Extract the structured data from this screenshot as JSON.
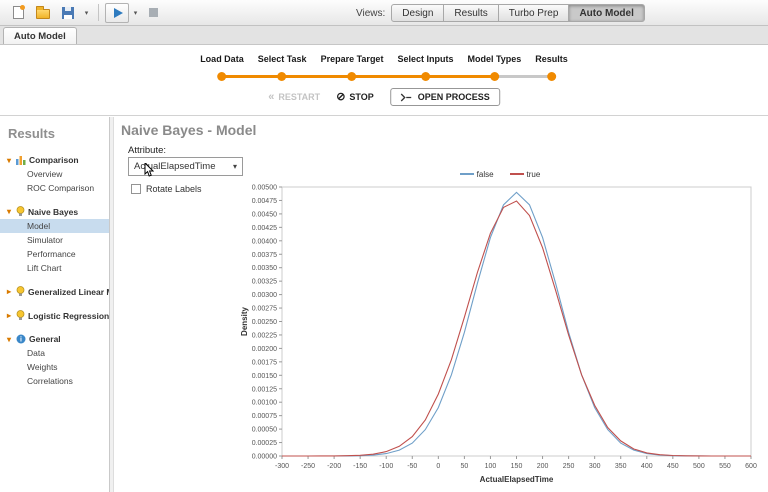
{
  "icons": {
    "expanded_arrow": "▾",
    "collapsed_arrow": "▸",
    "dropdown_caret": "▾",
    "restart_chevrons": "«",
    "stop_sign": "⊘"
  },
  "toolbar": {
    "views_label": "Views:",
    "view_buttons": [
      {
        "label": "Design",
        "active": false
      },
      {
        "label": "Results",
        "active": false
      },
      {
        "label": "Turbo Prep",
        "active": false
      },
      {
        "label": "Auto Model",
        "active": true
      }
    ]
  },
  "tabs": {
    "auto_model": "Auto Model"
  },
  "stepper": {
    "steps": [
      "Load Data",
      "Select Task",
      "Prepare Target",
      "Select Inputs",
      "Model Types",
      "Results"
    ],
    "completed_color": "#f08a00",
    "pending_color": "#c8c8c8",
    "completed_until_index": 4
  },
  "process_controls": {
    "restart": "RESTART",
    "stop": "STOP",
    "open_process": "OPEN PROCESS"
  },
  "sidebar": {
    "title": "Results",
    "tree": [
      {
        "label": "Comparison",
        "icon": "comparison-icon",
        "expanded": true,
        "children": [
          "Overview",
          "ROC Comparison"
        ]
      },
      {
        "label": "Naive Bayes",
        "icon": "bulb-icon",
        "expanded": true,
        "children": [
          "Model",
          "Simulator",
          "Performance",
          "Lift Chart"
        ],
        "selected": "Model"
      },
      {
        "label": "Generalized Linear Model",
        "icon": "bulb-icon",
        "expanded": false,
        "children": []
      },
      {
        "label": "Logistic Regression",
        "icon": "bulb-icon",
        "expanded": false,
        "children": []
      },
      {
        "label": "General",
        "icon": "info-icon",
        "expanded": true,
        "children": [
          "Data",
          "Weights",
          "Correlations"
        ]
      }
    ]
  },
  "main": {
    "title": "Naive Bayes - Model",
    "attribute_label": "Attribute:",
    "attribute_value": "ActualElapsedTime",
    "rotate_labels_label": "Rotate Labels",
    "rotate_labels_checked": false
  },
  "chart_data": {
    "type": "line",
    "title": "",
    "xlabel": "ActualElapsedTime",
    "ylabel": "Density",
    "xlim": [
      -300,
      600
    ],
    "ylim": [
      0,
      0.005
    ],
    "grid": false,
    "legend_position": "top",
    "x_ticks": [
      -300,
      -250,
      -200,
      -150,
      -100,
      -50,
      0,
      50,
      100,
      150,
      200,
      250,
      300,
      350,
      400,
      450,
      500,
      550,
      600
    ],
    "y_ticks": [
      "0.00000",
      "0.00025",
      "0.00050",
      "0.00075",
      "0.00100",
      "0.00125",
      "0.00150",
      "0.00175",
      "0.00200",
      "0.00225",
      "0.00250",
      "0.00275",
      "0.00300",
      "0.00325",
      "0.00350",
      "0.00375",
      "0.00400",
      "0.00425",
      "0.00450",
      "0.00475",
      "0.00500"
    ],
    "x": [
      -300,
      -275,
      -250,
      -225,
      -200,
      -175,
      -150,
      -125,
      -100,
      -75,
      -50,
      -25,
      0,
      25,
      50,
      75,
      100,
      125,
      150,
      175,
      200,
      225,
      250,
      275,
      300,
      325,
      350,
      375,
      400,
      425,
      450,
      475,
      500,
      525,
      550,
      575,
      600
    ],
    "series": [
      {
        "name": "false",
        "color": "#6f9fc8",
        "values": [
          0,
          0,
          0,
          0,
          0,
          2e-06,
          6e-06,
          1.6e-05,
          4.4e-05,
          0.00011,
          0.00024,
          0.00049,
          0.0009,
          0.00151,
          0.0023,
          0.00321,
          0.00406,
          0.00467,
          0.0049,
          0.00467,
          0.00406,
          0.00321,
          0.0023,
          0.00151,
          0.0009,
          0.00049,
          0.00024,
          0.00011,
          4.4e-05,
          1.6e-05,
          6e-06,
          2e-06,
          1e-06,
          0,
          0,
          0,
          0
        ]
      },
      {
        "name": "true",
        "color": "#c0504d",
        "values": [
          0,
          0,
          0,
          1e-06,
          1.5e-06,
          5e-06,
          1.3e-05,
          3.4e-05,
          8.2e-05,
          0.00018,
          0.00036,
          0.00067,
          0.00115,
          0.00179,
          0.00258,
          0.00341,
          0.00414,
          0.00462,
          0.00474,
          0.00447,
          0.00387,
          0.00308,
          0.00225,
          0.00151,
          0.00094,
          0.00053,
          0.00028,
          0.00013,
          5.8e-05,
          2.4e-05,
          9e-06,
          3e-06,
          1e-06,
          0,
          0,
          0,
          0
        ]
      }
    ]
  }
}
